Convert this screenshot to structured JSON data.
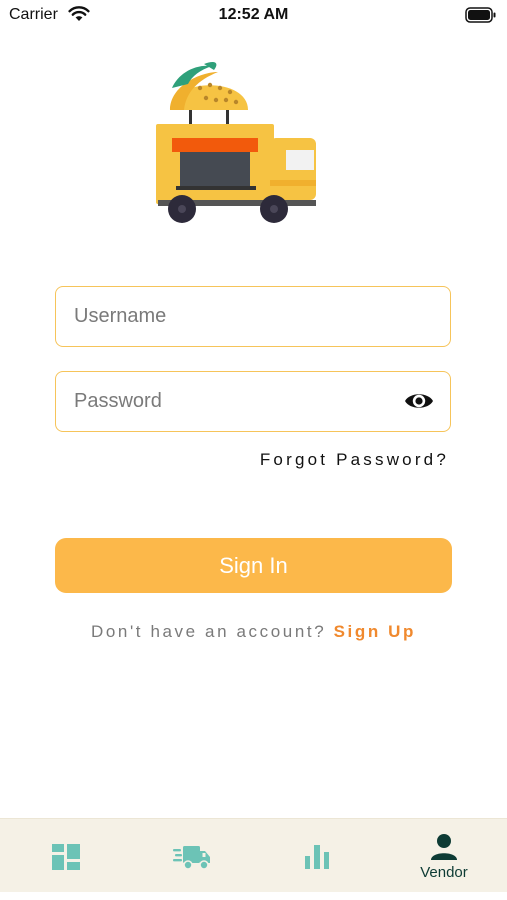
{
  "status_bar": {
    "carrier": "Carrier",
    "time": "12:52 AM"
  },
  "login": {
    "username_placeholder": "Username",
    "password_placeholder": "Password",
    "forgot_password": "Forgot Password?",
    "sign_in_label": "Sign In",
    "no_account_text": "Don't have an account?",
    "sign_up_label": "Sign Up"
  },
  "tab_bar": {
    "tabs": [
      {
        "icon": "dashboard-icon",
        "label": ""
      },
      {
        "icon": "delivery-truck-icon",
        "label": ""
      },
      {
        "icon": "bar-chart-icon",
        "label": ""
      },
      {
        "icon": "person-icon",
        "label": "Vendor",
        "active": true
      }
    ]
  },
  "colors": {
    "accent": "#fcb84a",
    "field_border": "#f6c45a",
    "sign_up": "#f0892e",
    "tab_icon": "#6cc3b6",
    "tab_active": "#0d3b34",
    "tab_bar_bg": "#f5f1e6"
  }
}
